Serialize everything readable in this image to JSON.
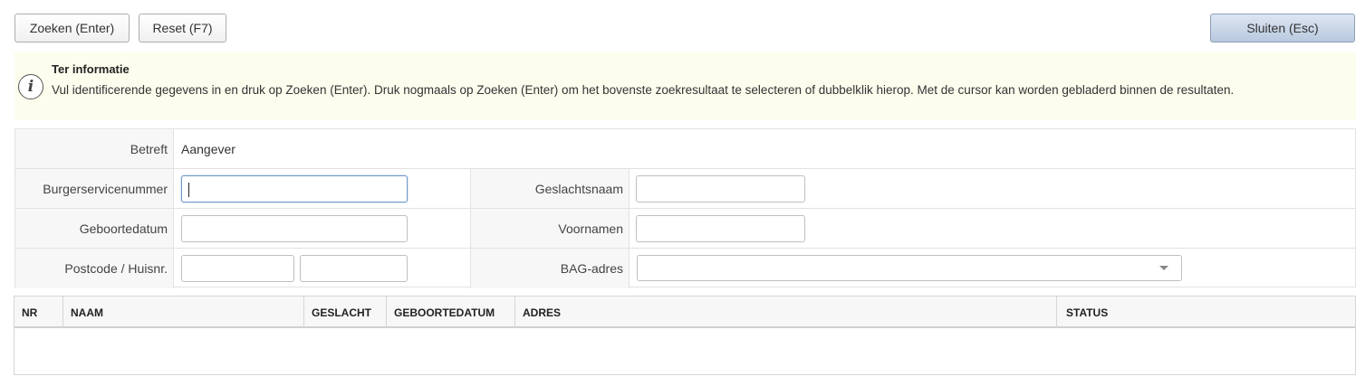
{
  "toolbar": {
    "search_label": "Zoeken (Enter)",
    "reset_label": "Reset (F7)",
    "close_label": "Sluiten (Esc)"
  },
  "info": {
    "icon": "info-icon",
    "icon_glyph": "i",
    "title": "Ter informatie",
    "text": "Vul identificerende gegevens in en druk op Zoeken (Enter). Druk nogmaals op Zoeken (Enter) om het bovenste zoekresultaat te selecteren of dubbelklik hierop. Met de cursor kan worden gebladerd binnen de resultaten."
  },
  "form": {
    "betreft_label": "Betreft",
    "betreft_value": "Aangever",
    "bsn_label": "Burgerservicenummer",
    "bsn_value": "",
    "geboortedatum_label": "Geboortedatum",
    "geboortedatum_value": "",
    "postcode_label": "Postcode / Huisnr.",
    "postcode_value": "",
    "huisnr_value": "",
    "geslachtsnaam_label": "Geslachtsnaam",
    "geslachtsnaam_value": "",
    "voornamen_label": "Voornamen",
    "voornamen_value": "",
    "bag_label": "BAG-adres",
    "bag_value": ""
  },
  "grid": {
    "columns": [
      "NR",
      "NAAM",
      "GESLACHT",
      "GEBOORTEDATUM",
      "ADRES",
      "STATUS"
    ],
    "rows": []
  },
  "colors": {
    "info_background": "#fdfdee",
    "close_button": "#c7d4e6",
    "label_background": "#f7f7f7"
  }
}
